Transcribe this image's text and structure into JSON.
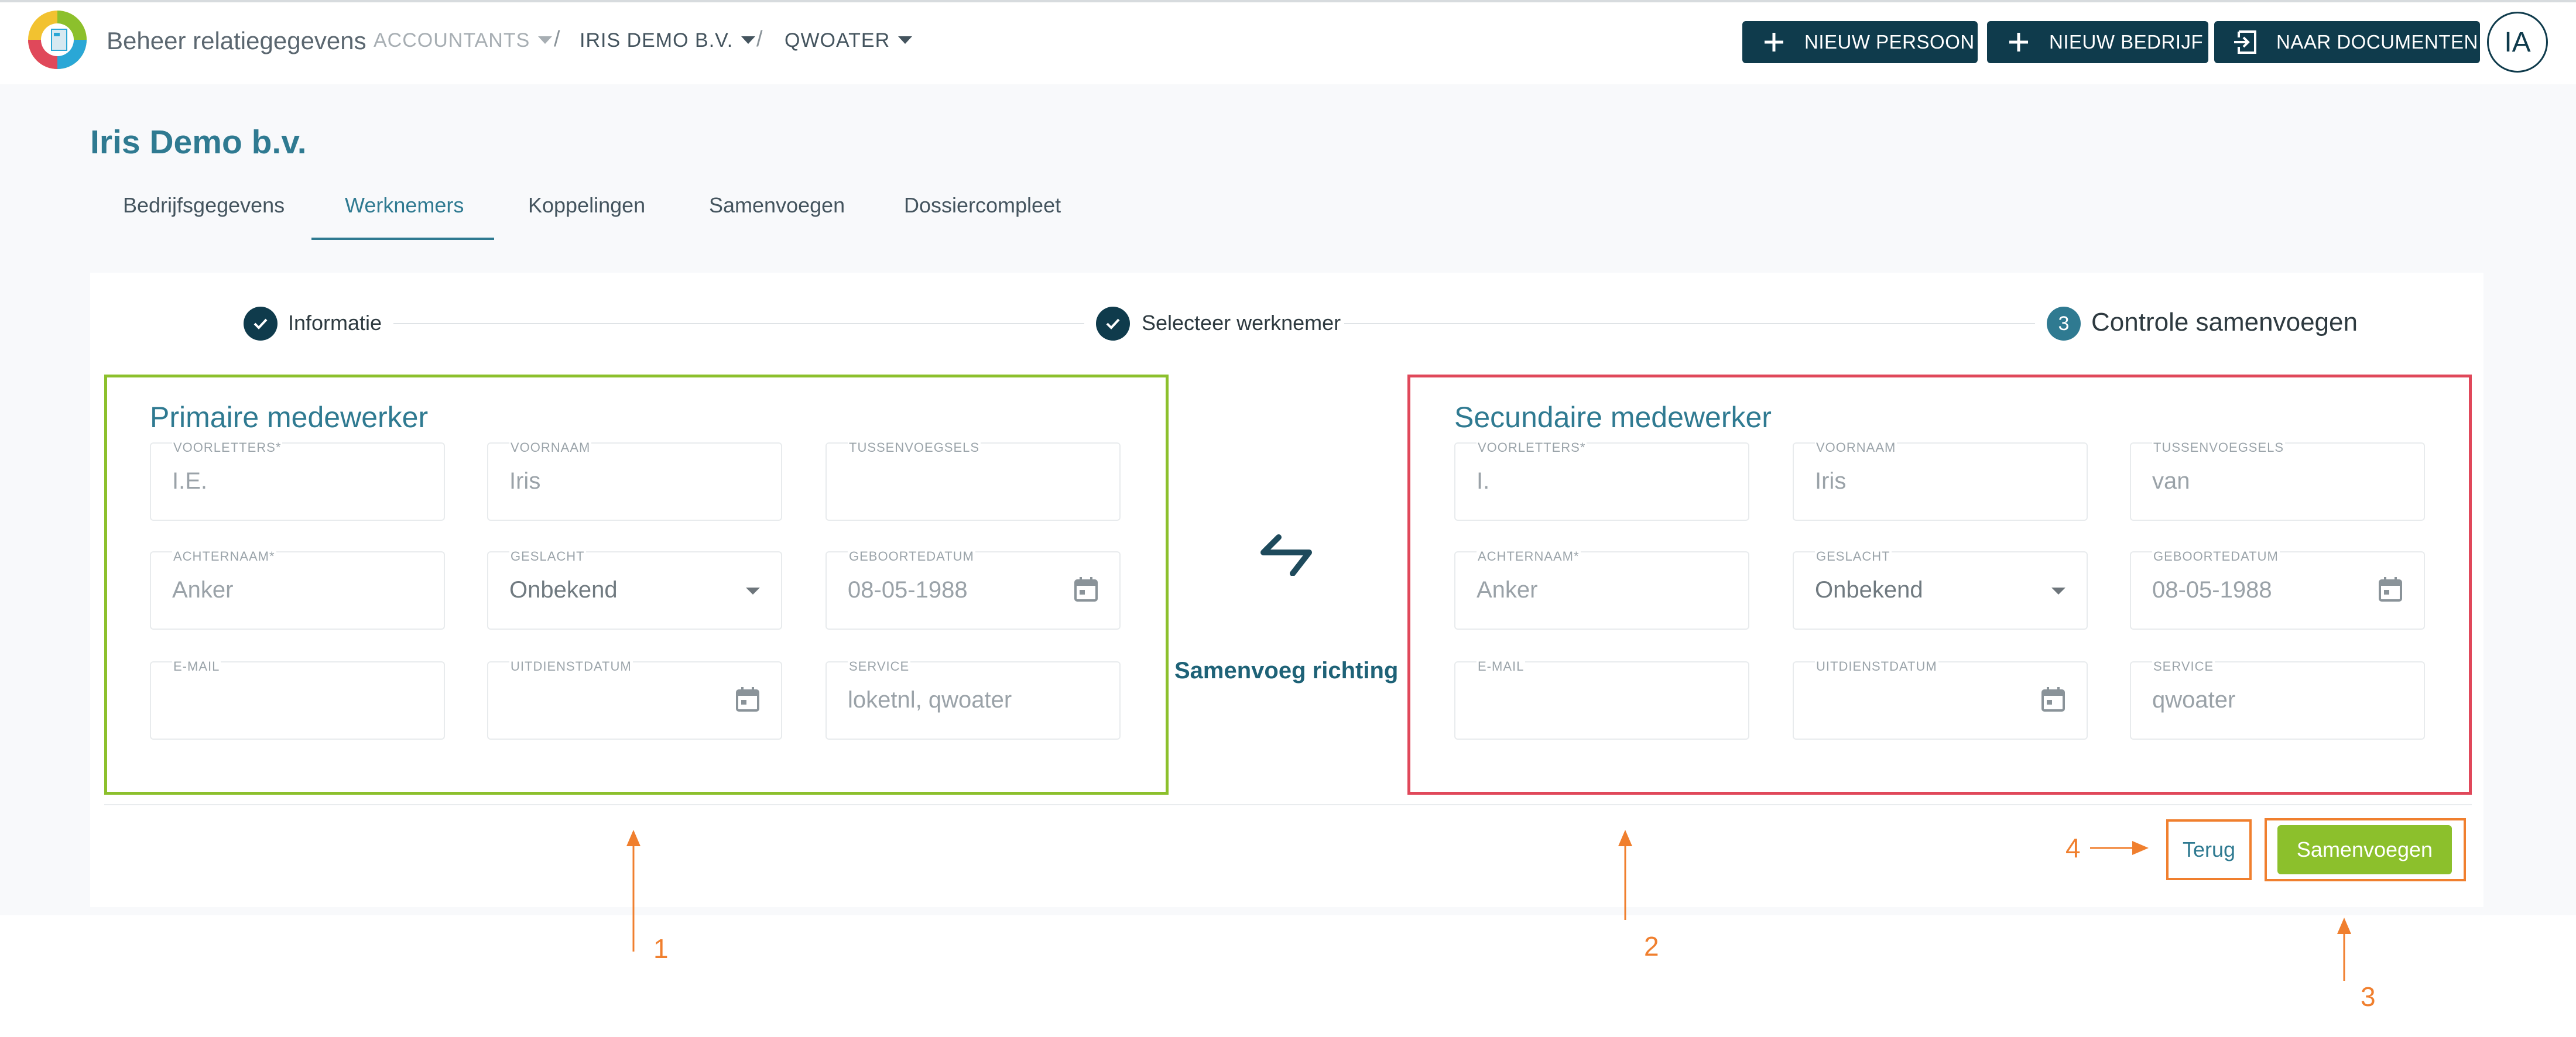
{
  "header": {
    "app_title": "Beheer relatiegegevens",
    "breadcrumbs": [
      {
        "label": "ACCOUNTANTS",
        "color": "#a7aeb3"
      },
      {
        "label": "IRIS DEMO B.V.",
        "color": "#44545e"
      },
      {
        "label": "QWOATER",
        "color": "#44545e"
      }
    ],
    "separator": "/",
    "buttons": {
      "new_person": "NIEUW PERSOON",
      "new_company": "NIEUW BEDRIJF",
      "to_documents": "NAAR DOCUMENTEN"
    },
    "avatar_initials": "IA"
  },
  "company_name": "Iris Demo b.v.",
  "tabs": [
    "Bedrijfsgegevens",
    "Werknemers",
    "Koppelingen",
    "Samenvoegen",
    "Dossiercompleet"
  ],
  "active_tab": "Werknemers",
  "steps": [
    {
      "label": "Informatie",
      "state": "done"
    },
    {
      "label": "Selecteer werknemer",
      "state": "done"
    },
    {
      "label": "Controle samenvoegen",
      "state": "current",
      "number": "3"
    }
  ],
  "primary": {
    "title": "Primaire medewerker",
    "fields": {
      "voorletters": {
        "label": "VOORLETTERS",
        "required": "*",
        "value": "I.E."
      },
      "voornaam": {
        "label": "VOORNAAM",
        "value": "Iris"
      },
      "tussenvoegsels": {
        "label": "TUSSENVOEGSELS",
        "value": ""
      },
      "achternaam": {
        "label": "ACHTERNAAM",
        "required": "*",
        "value": "Anker"
      },
      "geslacht": {
        "label": "GESLACHT",
        "value": "Onbekend"
      },
      "geboortedatum": {
        "label": "GEBOORTEDATUM",
        "value": "08-05-1988"
      },
      "email": {
        "label": "E-MAIL",
        "value": ""
      },
      "uitdienstdatum": {
        "label": "UITDIENSTDATUM",
        "value": ""
      },
      "service": {
        "label": "SERVICE",
        "value": "loketnl, qwoater"
      }
    }
  },
  "secondary": {
    "title": "Secundaire medewerker",
    "fields": {
      "voorletters": {
        "label": "VOORLETTERS",
        "required": "*",
        "value": "I."
      },
      "voornaam": {
        "label": "VOORNAAM",
        "value": "Iris"
      },
      "tussenvoegsels": {
        "label": "TUSSENVOEGSELS",
        "value": "van"
      },
      "achternaam": {
        "label": "ACHTERNAAM",
        "required": "*",
        "value": "Anker"
      },
      "geslacht": {
        "label": "GESLACHT",
        "value": "Onbekend"
      },
      "geboortedatum": {
        "label": "GEBOORTEDATUM",
        "value": "08-05-1988"
      },
      "email": {
        "label": "E-MAIL",
        "value": ""
      },
      "uitdienstdatum": {
        "label": "UITDIENSTDATUM",
        "value": ""
      },
      "service": {
        "label": "SERVICE",
        "value": "qwoater"
      }
    }
  },
  "merge_direction_label": "Samenvoeg richting",
  "actions": {
    "back": "Terug",
    "merge": "Samenvoegen"
  },
  "annotations": [
    "1",
    "2",
    "3",
    "4"
  ],
  "colors": {
    "primary_dark": "#0f3b4c",
    "accent_teal": "#2f7a91",
    "primary_border": "#8cc02c",
    "secondary_border": "#e0485a",
    "annotation_orange": "#f07f2e",
    "merge_button": "#8cc02c"
  }
}
